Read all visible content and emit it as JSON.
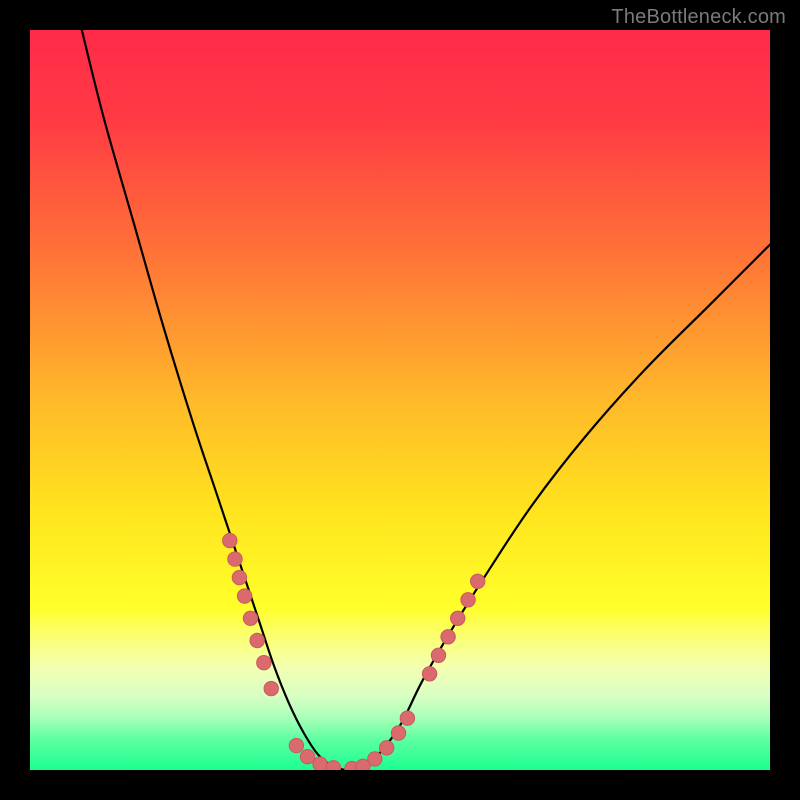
{
  "watermark": "TheBottleneck.com",
  "colors": {
    "frame": "#000000",
    "curve": "#000000",
    "dot_fill": "#da6a6d",
    "dot_stroke": "#c75a5d",
    "gradient_stops": [
      {
        "offset": 0.0,
        "color": "#ff2b49"
      },
      {
        "offset": 0.12,
        "color": "#ff3a44"
      },
      {
        "offset": 0.3,
        "color": "#ff7238"
      },
      {
        "offset": 0.5,
        "color": "#ffb92a"
      },
      {
        "offset": 0.65,
        "color": "#ffe41e"
      },
      {
        "offset": 0.78,
        "color": "#ffff2a"
      },
      {
        "offset": 0.82,
        "color": "#fbff73"
      },
      {
        "offset": 0.86,
        "color": "#f3ffb0"
      },
      {
        "offset": 0.9,
        "color": "#d9ffc4"
      },
      {
        "offset": 0.93,
        "color": "#a6ffb8"
      },
      {
        "offset": 0.96,
        "color": "#5bffa0"
      },
      {
        "offset": 1.0,
        "color": "#1bff90"
      }
    ]
  },
  "chart_data": {
    "type": "line",
    "title": "",
    "xlabel": "",
    "ylabel": "",
    "xlim": [
      0,
      100
    ],
    "ylim": [
      0,
      100
    ],
    "grid": false,
    "legend": false,
    "series": [
      {
        "name": "bottleneck-curve",
        "x": [
          7,
          10,
          14,
          18,
          22,
          25,
          27,
          29,
          31,
          33,
          35,
          37,
          39,
          41,
          43,
          45,
          47,
          50,
          53,
          57,
          62,
          68,
          75,
          83,
          92,
          100
        ],
        "y": [
          100,
          88,
          74,
          60,
          47,
          38,
          32,
          26,
          20,
          14,
          9,
          5,
          2,
          0.5,
          0,
          0.5,
          2,
          6,
          12,
          19,
          27,
          36,
          45,
          54,
          63,
          71
        ]
      }
    ],
    "points": [
      {
        "name": "left-cluster",
        "x": [
          27.0,
          27.7,
          28.3,
          29.0,
          29.8,
          30.7,
          31.6,
          32.6
        ],
        "y": [
          31,
          28.5,
          26,
          23.5,
          20.5,
          17.5,
          14.5,
          11
        ]
      },
      {
        "name": "bottom-cluster",
        "x": [
          36.0,
          37.5,
          39.2,
          41.0,
          43.5,
          45.0,
          46.6,
          48.2,
          49.8,
          51.0
        ],
        "y": [
          3.3,
          1.8,
          0.8,
          0.3,
          0.2,
          0.5,
          1.5,
          3.0,
          5.0,
          7.0
        ]
      },
      {
        "name": "right-cluster",
        "x": [
          54.0,
          55.2,
          56.5,
          57.8,
          59.2,
          60.5
        ],
        "y": [
          13,
          15.5,
          18,
          20.5,
          23,
          25.5
        ]
      }
    ]
  }
}
